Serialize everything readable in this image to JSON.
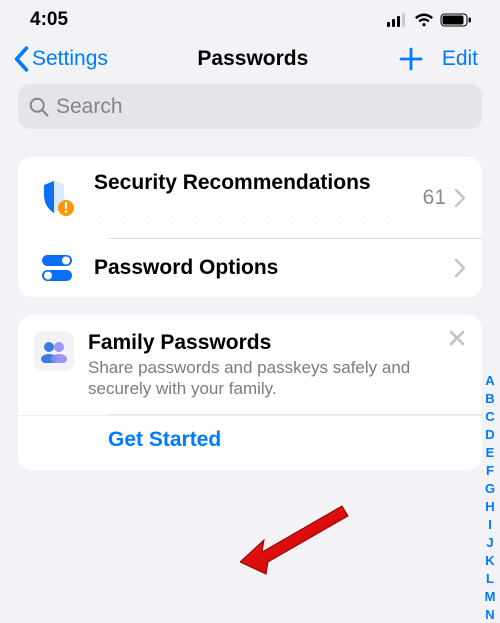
{
  "status": {
    "time": "4:05"
  },
  "nav": {
    "back_label": "Settings",
    "title": "Passwords",
    "edit_label": "Edit"
  },
  "search": {
    "placeholder": "Search"
  },
  "security": {
    "title": "Security Recommendations",
    "count": "61"
  },
  "options": {
    "title": "Password Options"
  },
  "family": {
    "title": "Family Passwords",
    "subtitle": "Share passwords and passkeys safely and securely with your family.",
    "cta": "Get Started"
  },
  "index_letters": [
    "A",
    "B",
    "C",
    "D",
    "E",
    "F",
    "G",
    "H",
    "I",
    "J",
    "K",
    "L",
    "M",
    "N"
  ]
}
